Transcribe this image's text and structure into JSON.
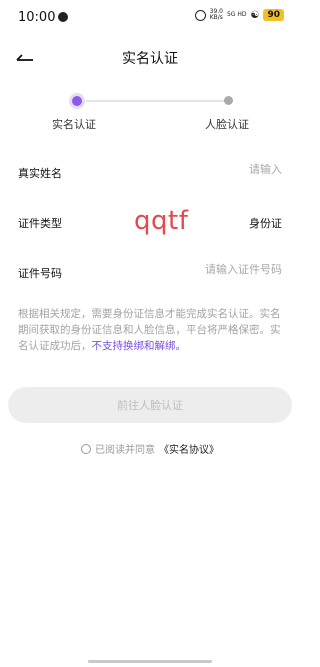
{
  "status_bar": {
    "time": "10:00",
    "speed_value": "39.0",
    "speed_unit": "KB/s",
    "network": "5G HD",
    "battery": "90"
  },
  "header": {
    "title": "实名认证"
  },
  "stepper": {
    "steps": [
      {
        "label": "实名认证",
        "state": "active"
      },
      {
        "label": "人脸认证",
        "state": "inactive"
      }
    ]
  },
  "form": {
    "name_label": "真实姓名",
    "name_placeholder": "请输入",
    "id_type_label": "证件类型",
    "id_type_value": "身份证",
    "id_number_label": "证件号码",
    "id_number_placeholder": "请输入证件号码"
  },
  "watermark_text": "qqtf",
  "notice": {
    "text": "根据相关规定，需要身份证信息才能完成实名认证。实名期间获取的身份证信息和人脸信息，平台将严格保密。实名认证成功后，",
    "highlight": "不支持换绑和解绑。"
  },
  "submit_button": {
    "label": "前往人脸认证"
  },
  "agreement": {
    "prefix": "已阅读并同意",
    "link": "《实名协议》",
    "checked": false
  },
  "colors": {
    "accent": "#8a5ae8",
    "watermark": "#e5484d",
    "button_bg": "#ededed"
  }
}
